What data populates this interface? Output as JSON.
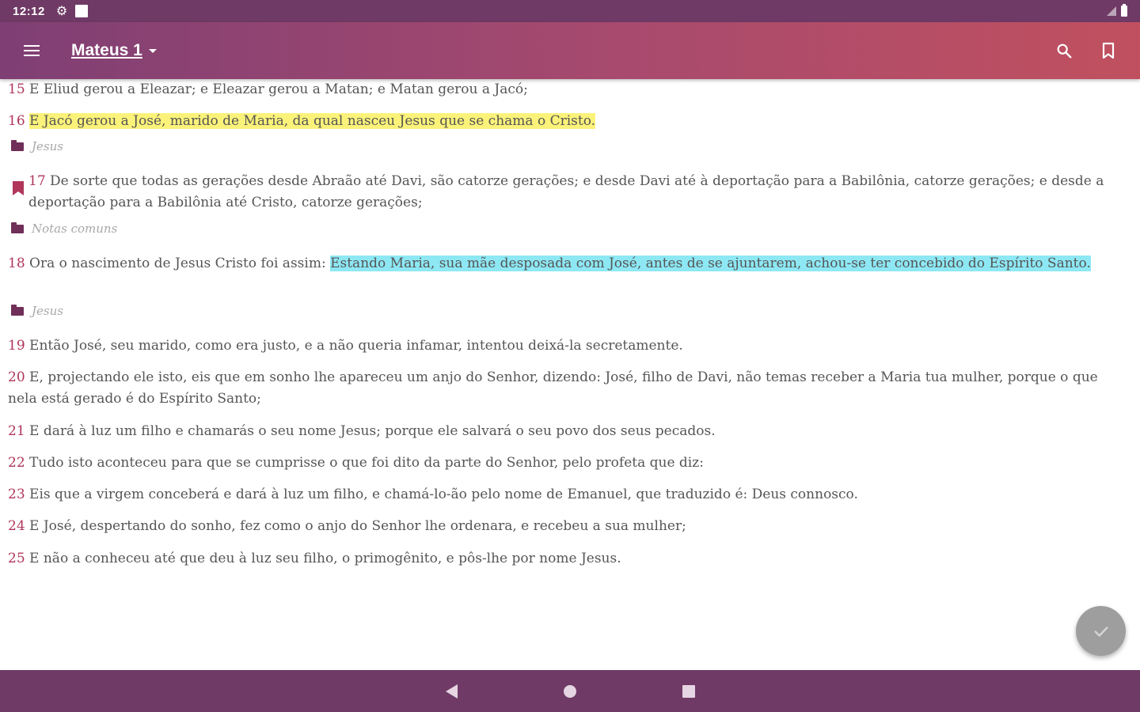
{
  "status_bar": {
    "time": "12:12"
  },
  "app_bar": {
    "title": "Mateus 1"
  },
  "verses": [
    {
      "num": "15",
      "text": "E Eliud gerou a Eleazar; e Eleazar gerou a Matan; e Matan gerou a Jacó;"
    },
    {
      "num": "16",
      "text": "E Jacó gerou a José, marido de Maria, da qual nasceu Jesus que se chama o Cristo."
    },
    {
      "num": "17",
      "text": "De sorte que todas as gerações desde Abraão até Davi, são catorze gerações; e desde Davi até à deportação para a Babilônia, catorze gerações; e desde a deportação para a Babilônia até Cristo, catorze gerações;"
    },
    {
      "num": "18",
      "text_plain": "Ora o nascimento de Jesus Cristo foi assim: ",
      "text_highlight": "Estando Maria, sua mãe desposada com José, antes de se ajuntarem, achou-se ter concebido do Espírito Santo."
    },
    {
      "num": "19",
      "text": "Então José, seu marido, como era justo, e a não queria infamar, intentou deixá-la secretamente."
    },
    {
      "num": "20",
      "text": "E, projectando ele isto, eis que em sonho lhe apareceu um anjo do Senhor, dizendo: José, filho de Davi, não temas receber a Maria tua mulher, porque o que nela está gerado é do Espírito Santo;"
    },
    {
      "num": "21",
      "text": "E dará à luz um filho e chamarás o seu nome Jesus; porque ele salvará o seu povo dos seus pecados."
    },
    {
      "num": "22",
      "text": "Tudo isto aconteceu para que se cumprisse o que foi dito da parte do Senhor, pelo profeta que diz:"
    },
    {
      "num": "23",
      "text": "Eis que a virgem conceberá e dará à luz um filho, e chamá-lo-ão pelo nome de Emanuel, que traduzido é: Deus connosco."
    },
    {
      "num": "24",
      "text": "E José, despertando do sonho, fez como o anjo do Senhor lhe ordenara, e recebeu a sua mulher;"
    },
    {
      "num": "25",
      "text": "E não a conheceu até que deu à luz seu filho, o primogênito, e pôs-lhe por nome Jesus."
    }
  ],
  "tags": {
    "v16": "Jesus",
    "v17": "Notas comuns",
    "v18": "Jesus"
  },
  "colors": {
    "highlight_yellow": "#fbf27a",
    "highlight_cyan": "#8de8f4",
    "verse_number": "#b0365a",
    "tag_folder": "#6f2f58",
    "bookmark": "#b0365a"
  }
}
